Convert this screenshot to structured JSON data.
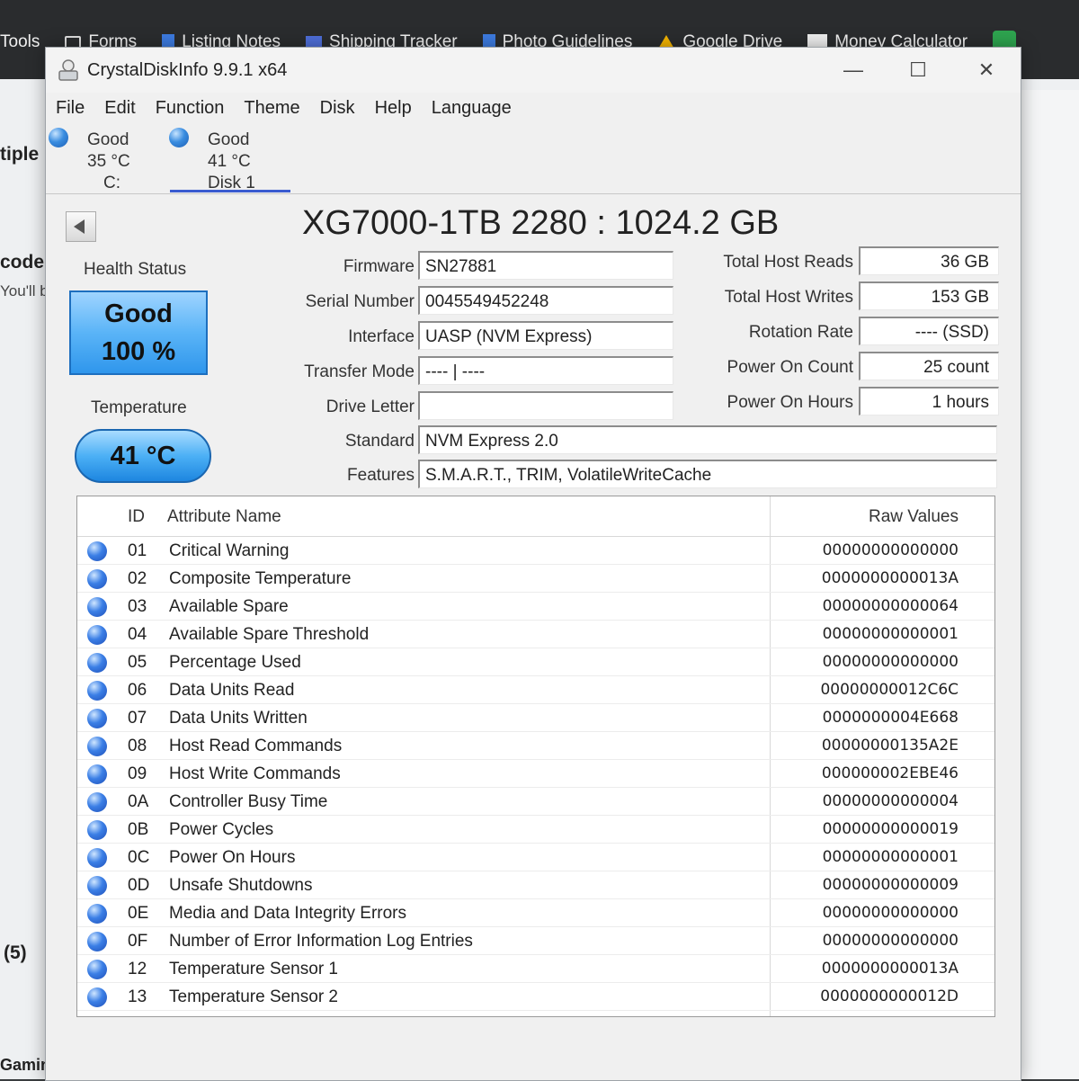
{
  "browser": {
    "bookmarks": [
      "Tools",
      "Forms",
      "Listing Notes",
      "Shipping Tracker",
      "Photo Guidelines",
      "Google Drive",
      "Money Calculator"
    ],
    "bg_fragments": [
      "tiple I",
      "code t",
      "You'll be",
      "(5)",
      "Gaming PC"
    ]
  },
  "window": {
    "title": "CrystalDiskInfo 9.9.1 x64",
    "controls": {
      "minimize": "—",
      "maximize": "☐",
      "close": "✕"
    }
  },
  "menu": [
    "File",
    "Edit",
    "Function",
    "Theme",
    "Disk",
    "Help",
    "Language"
  ],
  "disk_tabs": [
    {
      "status": "Good",
      "temp": "35 °C",
      "name": "C:"
    },
    {
      "status": "Good",
      "temp": "41 °C",
      "name": "Disk 1"
    }
  ],
  "disk": {
    "title": "XG7000-1TB 2280 : 1024.2 GB",
    "labels": {
      "health": "Health Status",
      "temperature": "Temperature",
      "firmware": "Firmware",
      "serial": "Serial Number",
      "interface": "Interface",
      "transfer": "Transfer Mode",
      "drive_letter": "Drive Letter",
      "standard": "Standard",
      "features": "Features",
      "host_reads": "Total Host Reads",
      "host_writes": "Total Host Writes",
      "rotation": "Rotation Rate",
      "power_count": "Power On Count",
      "power_hours": "Power On Hours"
    },
    "health_status": "Good",
    "health_percent": "100 %",
    "temperature": "41 °C",
    "firmware": "SN27881",
    "serial": "0045549452248",
    "interface": "UASP (NVM Express)",
    "transfer": "---- | ----",
    "drive_letter": "",
    "standard": "NVM Express 2.0",
    "features": "S.M.A.R.T., TRIM, VolatileWriteCache",
    "host_reads": "36 GB",
    "host_writes": "153 GB",
    "rotation": "---- (SSD)",
    "power_count": "25 count",
    "power_hours": "1 hours"
  },
  "smart": {
    "headers": {
      "id": "ID",
      "name": "Attribute Name",
      "raw": "Raw Values"
    },
    "rows": [
      {
        "id": "01",
        "name": "Critical Warning",
        "raw": "00000000000000"
      },
      {
        "id": "02",
        "name": "Composite Temperature",
        "raw": "0000000000013A"
      },
      {
        "id": "03",
        "name": "Available Spare",
        "raw": "00000000000064"
      },
      {
        "id": "04",
        "name": "Available Spare Threshold",
        "raw": "00000000000001"
      },
      {
        "id": "05",
        "name": "Percentage Used",
        "raw": "00000000000000"
      },
      {
        "id": "06",
        "name": "Data Units Read",
        "raw": "00000000012C6C"
      },
      {
        "id": "07",
        "name": "Data Units Written",
        "raw": "0000000004E668"
      },
      {
        "id": "08",
        "name": "Host Read Commands",
        "raw": "00000000135A2E"
      },
      {
        "id": "09",
        "name": "Host Write Commands",
        "raw": "000000002EBE46"
      },
      {
        "id": "0A",
        "name": "Controller Busy Time",
        "raw": "00000000000004"
      },
      {
        "id": "0B",
        "name": "Power Cycles",
        "raw": "00000000000019"
      },
      {
        "id": "0C",
        "name": "Power On Hours",
        "raw": "00000000000001"
      },
      {
        "id": "0D",
        "name": "Unsafe Shutdowns",
        "raw": "00000000000009"
      },
      {
        "id": "0E",
        "name": "Media and Data Integrity Errors",
        "raw": "00000000000000"
      },
      {
        "id": "0F",
        "name": "Number of Error Information Log Entries",
        "raw": "00000000000000"
      },
      {
        "id": "12",
        "name": "Temperature Sensor 1",
        "raw": "0000000000013A"
      },
      {
        "id": "13",
        "name": "Temperature Sensor 2",
        "raw": "0000000000012D"
      }
    ]
  }
}
